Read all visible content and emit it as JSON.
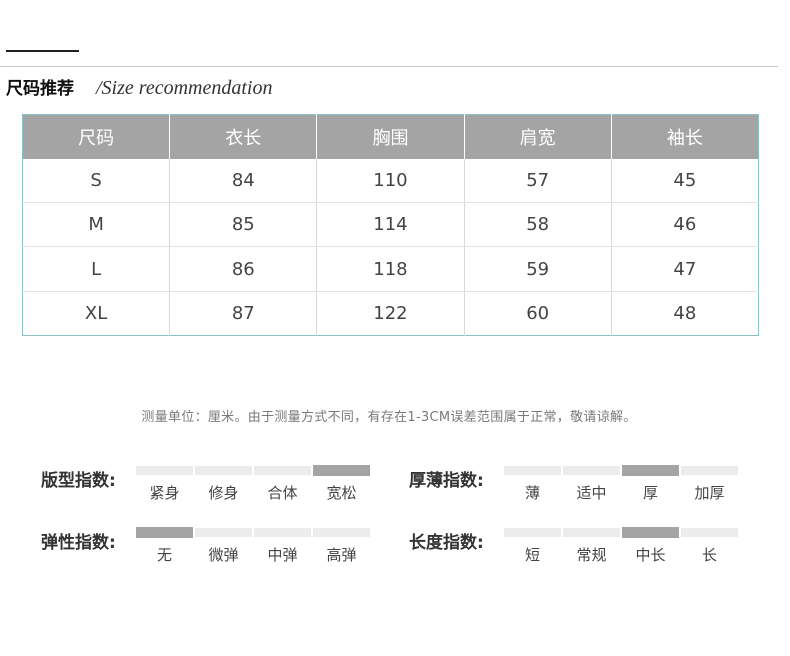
{
  "heading": {
    "cn": "尺码推荐",
    "en": "/Size recommendation"
  },
  "table": {
    "headers": [
      "尺码",
      "衣长",
      "胸围",
      "肩宽",
      "袖长"
    ],
    "rows": [
      [
        "S",
        "84",
        "110",
        "57",
        "45"
      ],
      [
        "M",
        "85",
        "114",
        "58",
        "46"
      ],
      [
        "L",
        "86",
        "118",
        "59",
        "47"
      ],
      [
        "XL",
        "87",
        "122",
        "60",
        "48"
      ]
    ]
  },
  "note": "测量单位：厘米。由于测量方式不同，有存在1-3CM误差范围属于正常，敬请谅解。",
  "indices": [
    {
      "label": "版型指数:",
      "options": [
        "紧身",
        "修身",
        "合体",
        "宽松"
      ],
      "selected": "宽松"
    },
    {
      "label": "厚薄指数:",
      "options": [
        "薄",
        "适中",
        "厚",
        "加厚"
      ],
      "selected": "厚"
    },
    {
      "label": "弹性指数:",
      "options": [
        "无",
        "微弹",
        "中弹",
        "高弹"
      ],
      "selected": "无"
    },
    {
      "label": "长度指数:",
      "options": [
        "短",
        "常规",
        "中长",
        "长"
      ],
      "selected": "中长"
    }
  ]
}
